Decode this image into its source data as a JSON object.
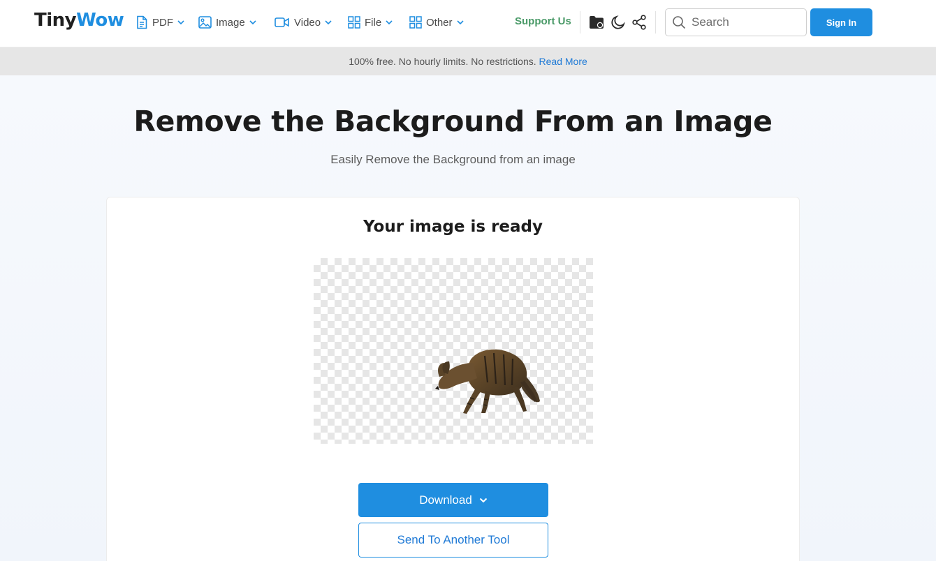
{
  "header": {
    "logo_part1": "Tiny",
    "logo_part2": "Wow",
    "nav": [
      {
        "label": "PDF",
        "icon": "document-icon"
      },
      {
        "label": "Image",
        "icon": "image-icon"
      },
      {
        "label": "Video",
        "icon": "video-camera-icon"
      },
      {
        "label": "File",
        "icon": "grid-icon"
      },
      {
        "label": "Other",
        "icon": "grid-icon"
      }
    ],
    "support_label": "Support Us",
    "search_placeholder": "Search",
    "signin_label": "Sign In"
  },
  "banner": {
    "text": "100% free. No hourly limits. No restrictions. ",
    "link": "Read More"
  },
  "hero": {
    "title": "Remove the Background From an Image",
    "subtitle": "Easily Remove the Background from an image"
  },
  "result": {
    "title": "Your image is ready",
    "download_label": "Download",
    "send_label": "Send To Another Tool"
  },
  "colors": {
    "accent": "#1f8ee0",
    "support_green": "#4a9a68",
    "banner_bg": "#e6e6e6"
  }
}
